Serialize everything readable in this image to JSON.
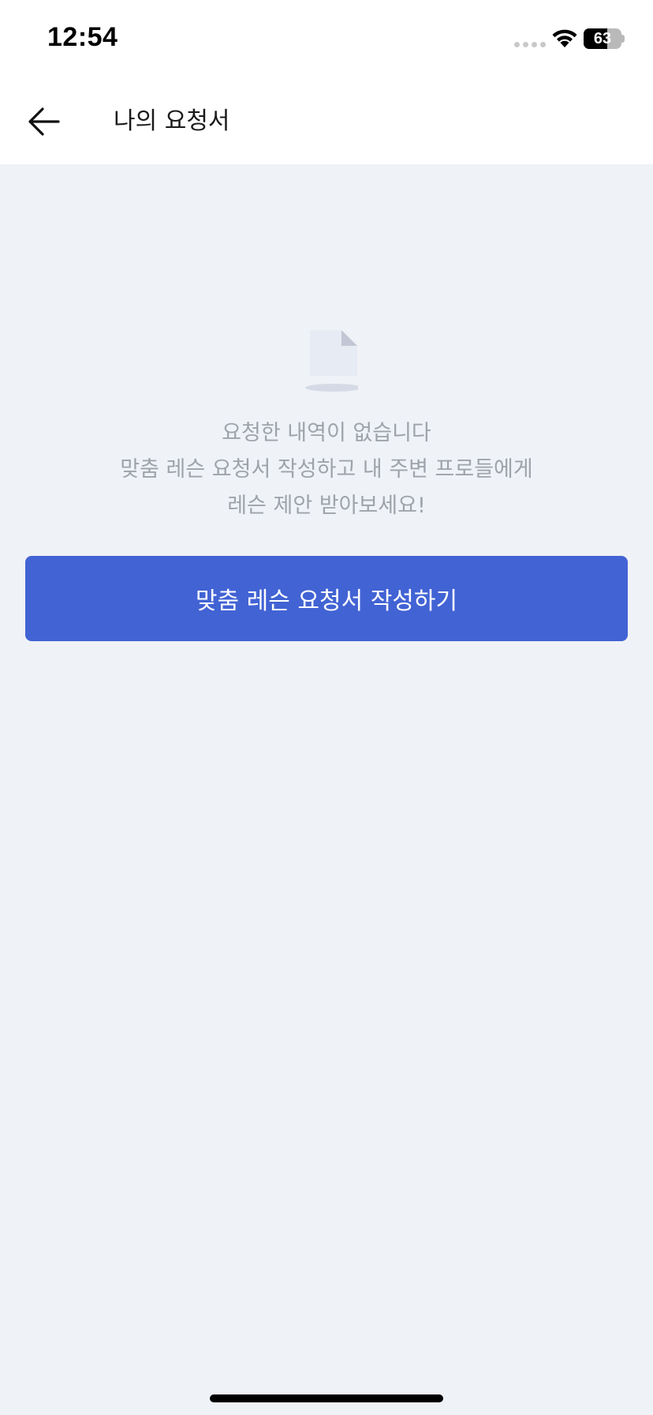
{
  "status_bar": {
    "time": "12:54",
    "battery_level": "63",
    "battery_fraction": 0.63
  },
  "header": {
    "title": "나의 요청서",
    "back_icon": "arrow-left-icon"
  },
  "empty_state": {
    "icon": "document-icon",
    "line1": "요청한 내역이 없습니다",
    "line2": "맞춤 레슨 요청서 작성하고 내 주변 프로들에게",
    "line3": "레슨 제안 받아보세요!"
  },
  "cta": {
    "label": "맞춤 레슨 요청서 작성하기"
  },
  "colors": {
    "background": "#eff2f6",
    "primary": "#4263d4",
    "muted_text": "#9ea3ab",
    "doc_icon": "#e6ebf4",
    "doc_fold": "#c1c7d4"
  }
}
